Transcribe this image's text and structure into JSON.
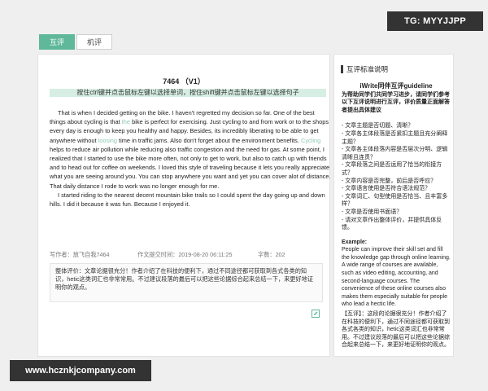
{
  "tabs": [
    {
      "label": "互评",
      "active": true
    },
    {
      "label": "机评",
      "active": false
    }
  ],
  "essay": {
    "title": "7464 （V1）",
    "hint": "按住ctrl键并点击鼠标左键以选择单词，按住shift键并点击鼠标左键以选择句子",
    "paragraphs": [
      [
        {
          "t": "That is when I decided getting on the bike.  I haven't regretted my decision so far.  One of the best things about cycling is that "
        },
        {
          "t": "the",
          "hl": true
        },
        {
          "t": " bike is perfect for exercising.  Just cycling to and from work or to the shops every day is enough to keep you healthy and happy.  Besides, its incredibly liberating to be able to get anywhere without "
        },
        {
          "t": "loosing",
          "hl": true
        },
        {
          "t": " time in traffic jams.  Also don't forget about the environment benefits.  "
        },
        {
          "t": "Cycling",
          "hl": true
        },
        {
          "t": " helps to reduce air pollution while reducing also traffic congestion and the need for gas.  At some point, I realized that I started to use the bike more often, not only to get to work, but also to catch up with friends and to head out for coffee on weekends.  I loved this style of traveling because it lets you really appreciate what you are seeing around you.  You can stop anywhere you want and yet you can cover alot of distance.  That daily distance I rode to work was no longer enough for me."
        }
      ],
      [
        {
          "t": "I started riding to the nearest decent mountain bike trails so I could spent the day going up and down hills.  I did it because it was fun.  Because I enjoyed it."
        }
      ]
    ]
  },
  "meta": {
    "author": "写作者：放飞自我7464",
    "submit_time": "作文提交时间：2019-08-20 06:11:25",
    "word_count": "字数：202"
  },
  "review": {
    "text": "整体评价：文章论据很充分！作者介绍了在科技的便利下，通过不同途径都可获取到各式各类的知识，hetic这类词汇也非常常用。不过建议段落的最后可以把这些论据综合起来总结一下，来更好地证明你的观点。"
  },
  "right_panel": {
    "header": "互评标准说明",
    "guideline_title": "iWrite同伴互评guideline",
    "intro": "为帮助同学们共同学习进步，请同学们参考以下互评说明进行互评，评价质量正面解答者提出具体建议",
    "criteria": [
      "- 文章主题是否切题、清晰？",
      "- 文章各主体段落是否紧扣主题且充分阐释主题？",
      "- 文章各主体段落内容是否层次分明、逻辑清晰且连贯？",
      "- 文章段落之间是否运用了恰当的衔接方式？",
      "- 文章内容是否完整，前后是否呼应？",
      "- 文章语言使用是否符合语法规范？",
      "- 文章词汇、句型使用是否恰当、且丰富多样？",
      "- 文章是否使用书面语？",
      "- 请对文章作出整体评价，并提供具体反馈。"
    ],
    "example_label": "Example:",
    "example_text": "People can improve their skill set and fill the knowledge gap through online learning. A wide range of courses are available, such as video editing, accounting, and second-language courses. The convenience of these online courses also makes them especially suitable for people who lead a hectic life.",
    "example_review": "【互评】：这段的论据很充分！作者介绍了在科技的便利下，通过不同途径都可获取到各式各类的知识，hetic这类词汇也非常常用。不过建议段落的最后可以把这些论据综合起来总结一下，来更好地证明你的观点。"
  },
  "watermarks": {
    "tg": "TG: MYYJJPP",
    "url": "www.hcznkjcompany.com"
  },
  "colors": {
    "accent": "#5fb89a",
    "hint_bg": "#d6eee3",
    "highlight": "#8fc8b2"
  }
}
